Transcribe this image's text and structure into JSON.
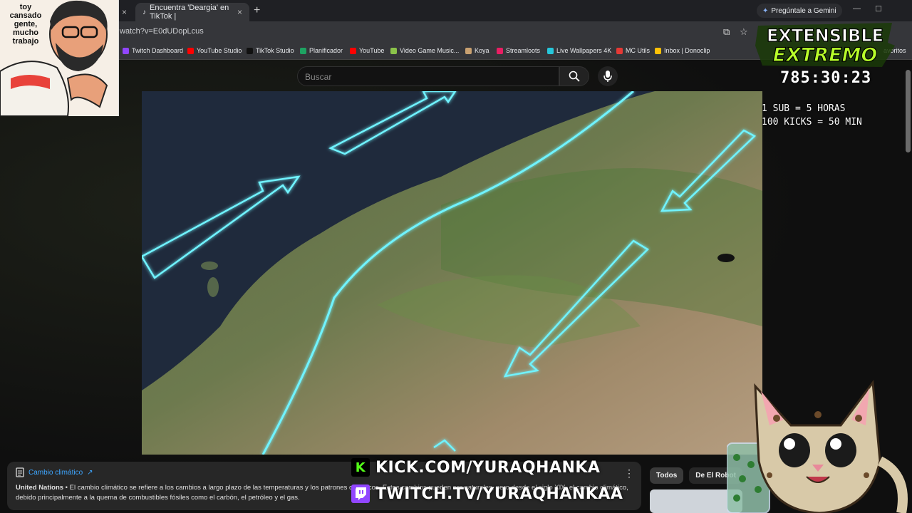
{
  "browser": {
    "tabs": [
      {
        "label": ""
      },
      {
        "label": "Encuentra 'Deargia' en TikTok |"
      }
    ],
    "close": "×",
    "new_tab": "+",
    "gemini_label": "Pregúntale a Gemini",
    "url": "watch?v=E0dUDopLcus",
    "bookmarks": [
      {
        "label": "Twitch Dashboard",
        "color": "#9146ff"
      },
      {
        "label": "YouTube Studio",
        "color": "#ff0000"
      },
      {
        "label": "TikTok Studio",
        "color": "#111111"
      },
      {
        "label": "Planificador",
        "color": "#1ea362"
      },
      {
        "label": "YouTube",
        "color": "#ff0000"
      },
      {
        "label": "Video Game Music...",
        "color": "#8bc34a"
      },
      {
        "label": "Koya",
        "color": "#c8a070"
      },
      {
        "label": "Streamloots",
        "color": "#e91e63"
      },
      {
        "label": "Live Wallpapers 4K",
        "color": "#26c6da"
      },
      {
        "label": "MC Utils",
        "color": "#e53935"
      },
      {
        "label": "Inbox | Donoclip",
        "color": "#ffc107"
      }
    ],
    "bookmarks_more": "avoritos"
  },
  "youtube": {
    "search_placeholder": "Buscar",
    "info_card": {
      "title": "Cambio climático",
      "source": "United Nations",
      "text": " • El cambio climático se refiere a los cambios a largo plazo de las temperaturas y los patrones climáticos. Estos cambios pueden ser naturales, pero desde el siglo XIX, el cambio climático, debido principalmente a la quema de combustibles fósiles como el carbón, el petróleo y el gas."
    },
    "chips": [
      "Todos",
      "De El Robot"
    ]
  },
  "overlay": {
    "speech": "toy cansado gente, mucho trabajo",
    "logo_line1": "EXTENSIBLE",
    "logo_line2": "EXTREMO",
    "timer": "785:30:23",
    "rule1": "1 SUB = 5 HORAS",
    "rule2": "100 KICKS = 50 MIN",
    "kick": "KICK.COM/YURAQHANKA",
    "twitch": "TWITCH.TV/YURAQHANKAA",
    "kick_letter": "K"
  }
}
